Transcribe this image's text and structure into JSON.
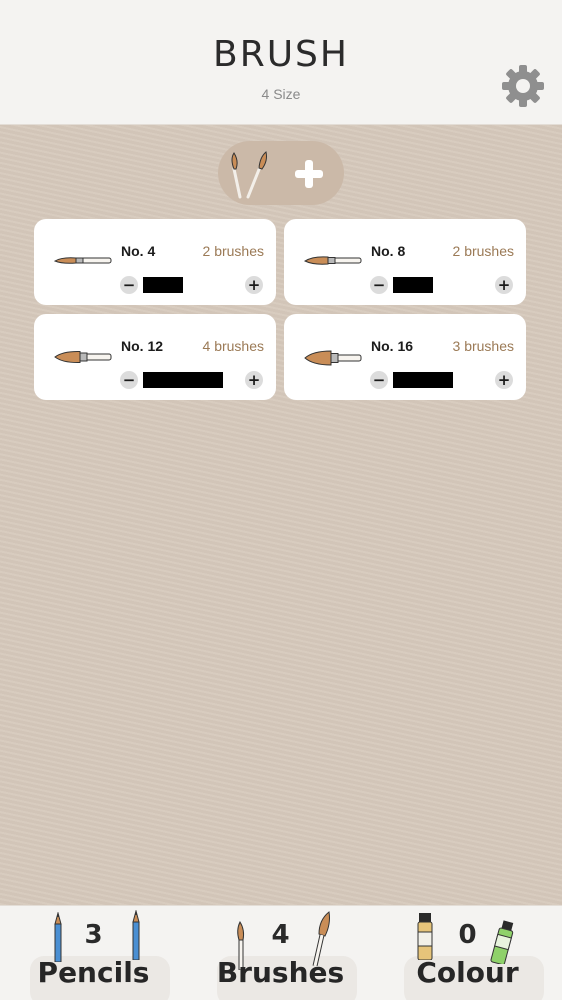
{
  "header": {
    "title": "BRUSH",
    "subtitle": "4 Size",
    "settings_icon": "gear-icon"
  },
  "add_button": {
    "icon": "plus-icon"
  },
  "cards": [
    {
      "size": "No. 4",
      "count": "2 brushes",
      "quantity_fraction": 0.25
    },
    {
      "size": "No. 8",
      "count": "2 brushes",
      "quantity_fraction": 0.25
    },
    {
      "size": "No. 12",
      "count": "4 brushes",
      "quantity_fraction": 0.5
    },
    {
      "size": "No. 16",
      "count": "3 brushes",
      "quantity_fraction": 0.375
    }
  ],
  "footer": {
    "tabs": [
      {
        "label": "Pencils",
        "count": "3"
      },
      {
        "label": "Brushes",
        "count": "4"
      },
      {
        "label": "Colour",
        "count": "0"
      }
    ]
  },
  "colors": {
    "background": "#d6c9bc",
    "header": "#f4f3f1",
    "accent_brown": "#9b7a56",
    "brush_tip": "#c98d57"
  }
}
